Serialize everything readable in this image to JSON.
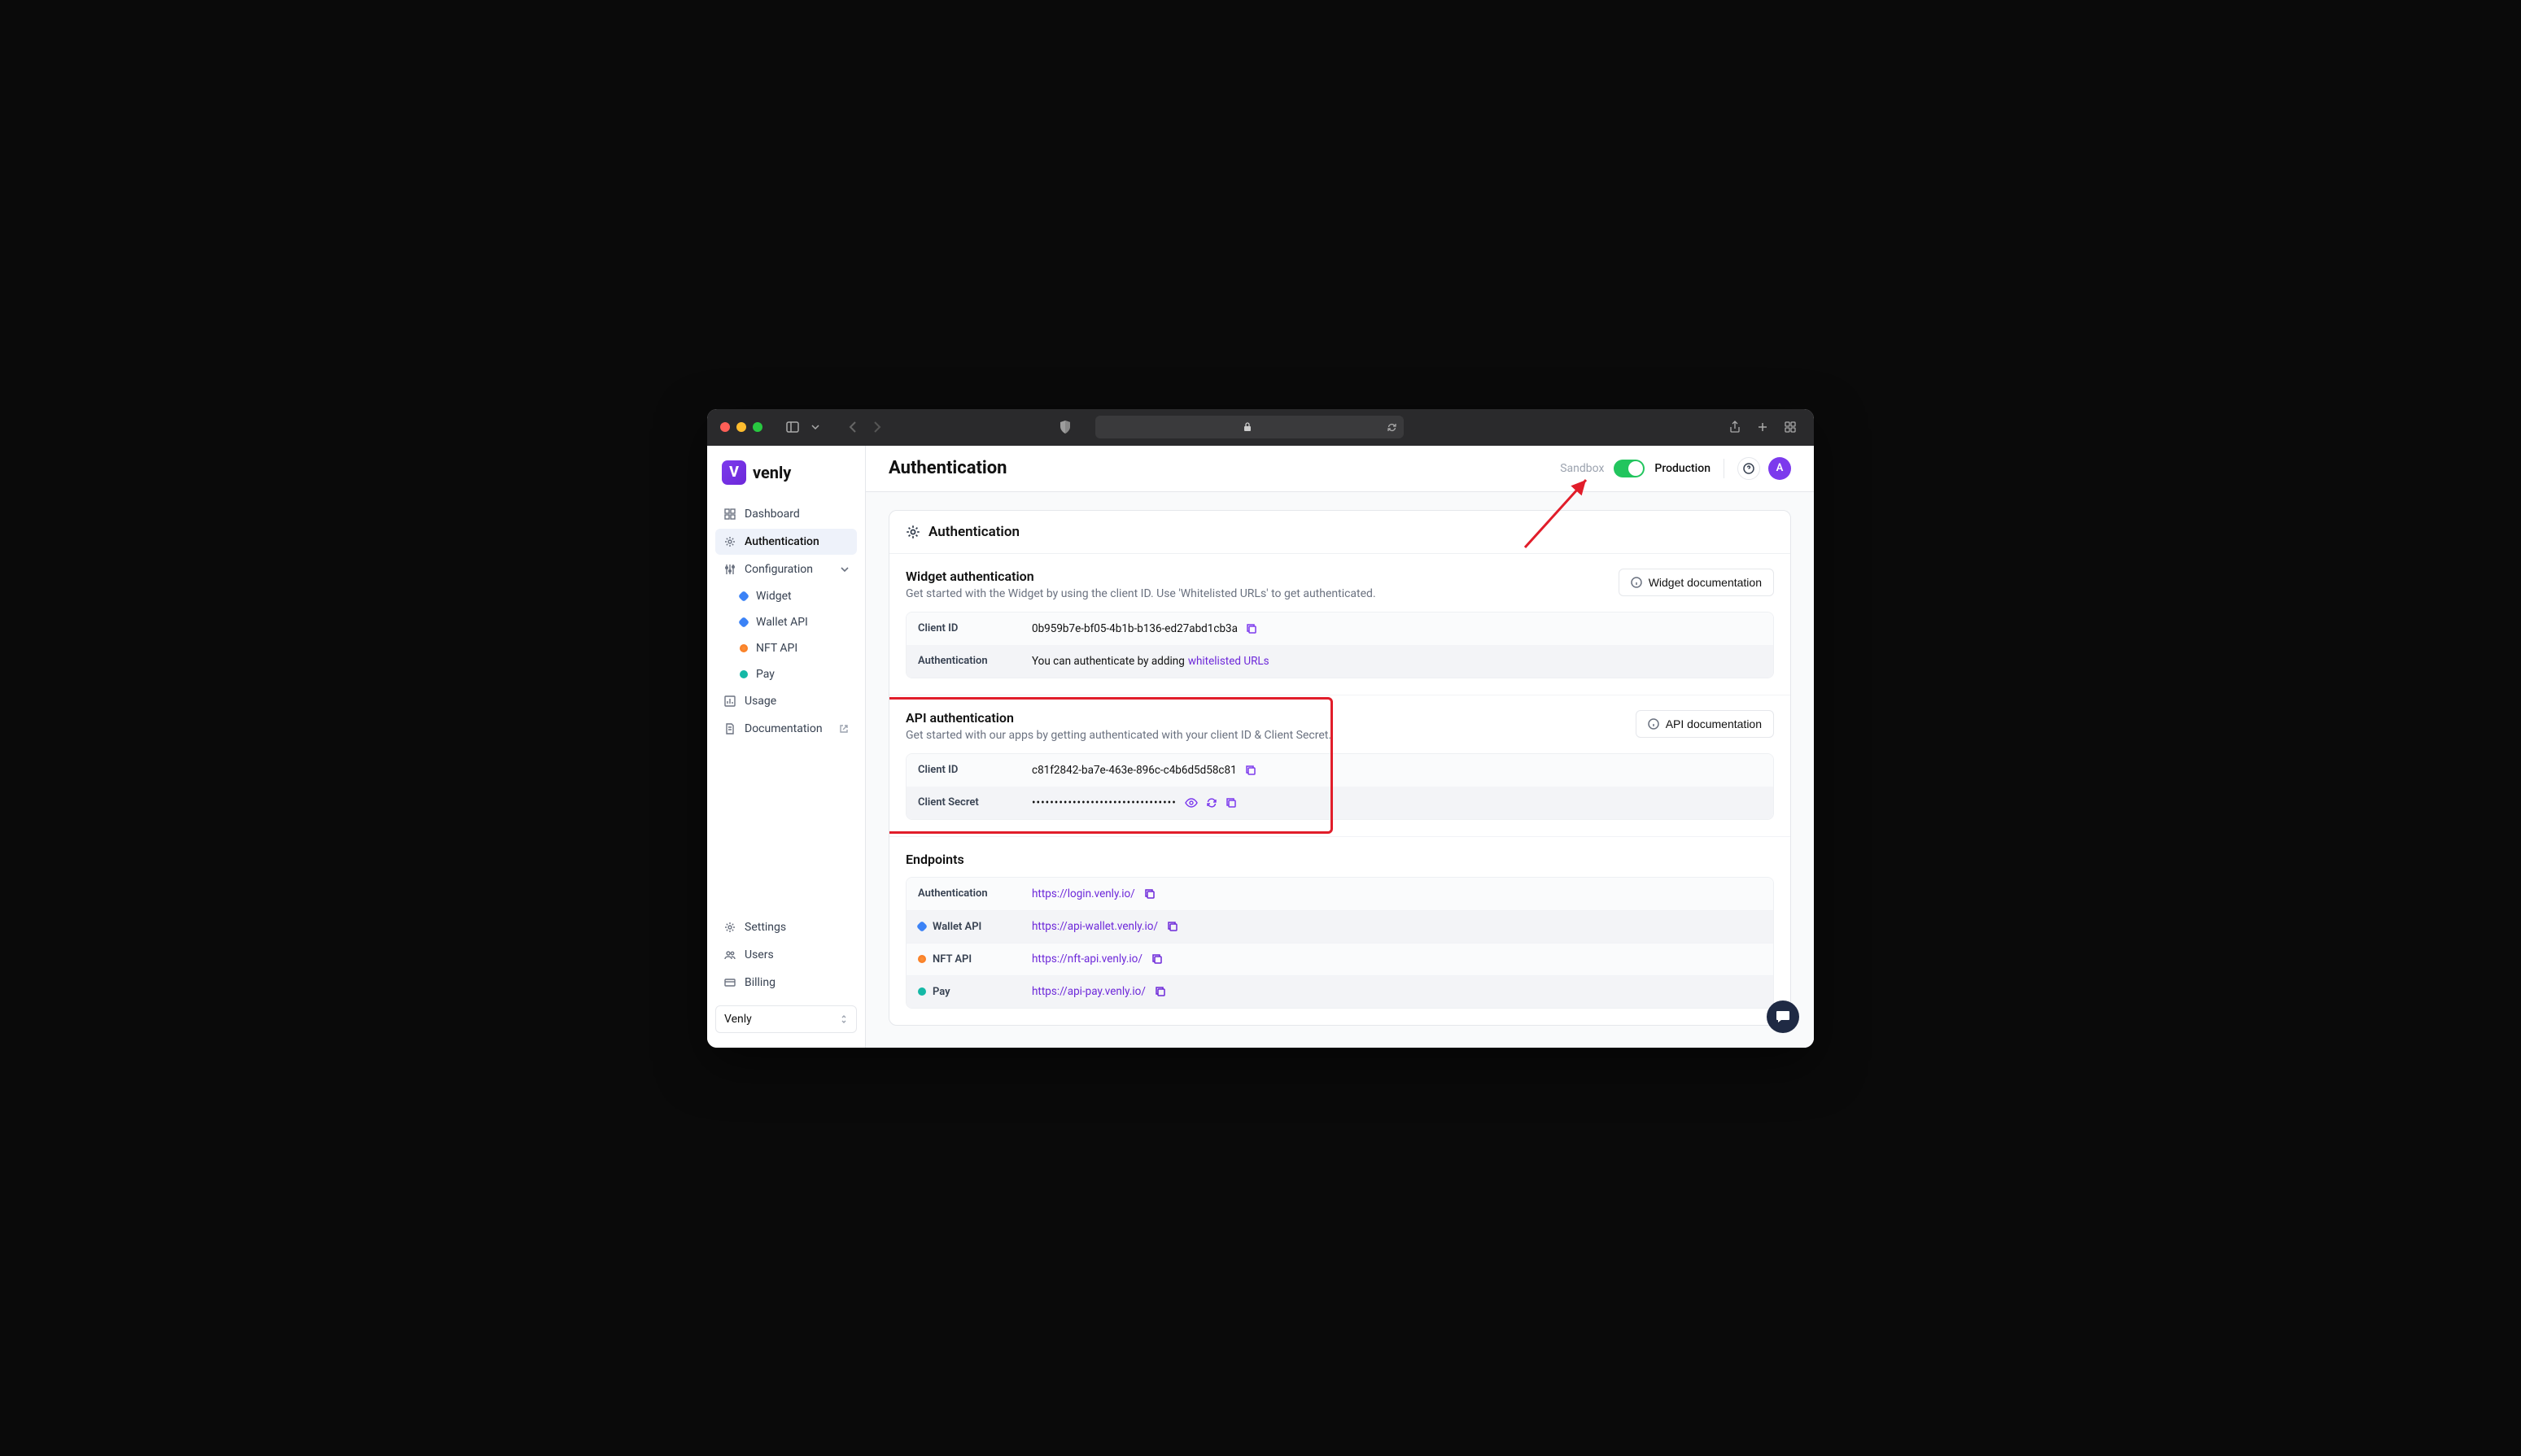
{
  "brand": {
    "name": "venly",
    "mark": "V"
  },
  "sidebar": {
    "items": [
      {
        "label": "Dashboard"
      },
      {
        "label": "Authentication"
      },
      {
        "label": "Configuration"
      },
      {
        "label": "Usage"
      },
      {
        "label": "Documentation"
      }
    ],
    "config_children": [
      {
        "label": "Widget",
        "color": "blue"
      },
      {
        "label": "Wallet API",
        "color": "blue"
      },
      {
        "label": "NFT API",
        "color": "orange"
      },
      {
        "label": "Pay",
        "color": "teal"
      }
    ],
    "bottom": [
      {
        "label": "Settings"
      },
      {
        "label": "Users"
      },
      {
        "label": "Billing"
      }
    ],
    "org": "Venly"
  },
  "header": {
    "title": "Authentication",
    "env_left": "Sandbox",
    "env_right": "Production",
    "avatar": "A"
  },
  "card_title": "Authentication",
  "widget_auth": {
    "title": "Widget authentication",
    "desc": "Get started with the Widget by using the client ID. Use 'Whitelisted URLs' to get authenticated.",
    "doc_btn": "Widget documentation",
    "rows": {
      "client_id_label": "Client ID",
      "client_id_value": "0b959b7e-bf05-4b1b-b136-ed27abd1cb3a",
      "auth_label": "Authentication",
      "auth_prefix": "You can authenticate by adding ",
      "auth_link": "whitelisted URLs"
    }
  },
  "api_auth": {
    "title": "API authentication",
    "desc": "Get started with our apps by getting authenticated with your client ID & Client Secret.",
    "doc_btn": "API documentation",
    "rows": {
      "client_id_label": "Client ID",
      "client_id_value": "c81f2842-ba7e-463e-896c-c4b6d5d58c81",
      "secret_label": "Client Secret",
      "secret_value": "••••••••••••••••••••••••••••••••"
    }
  },
  "endpoints": {
    "title": "Endpoints",
    "rows": [
      {
        "label": "Authentication",
        "url": "https://login.venly.io/",
        "dot": ""
      },
      {
        "label": "Wallet API",
        "url": "https://api-wallet.venly.io/",
        "dot": "blue"
      },
      {
        "label": "NFT API",
        "url": "https://nft-api.venly.io/",
        "dot": "orange"
      },
      {
        "label": "Pay",
        "url": "https://api-pay.venly.io/",
        "dot": "teal"
      }
    ]
  }
}
